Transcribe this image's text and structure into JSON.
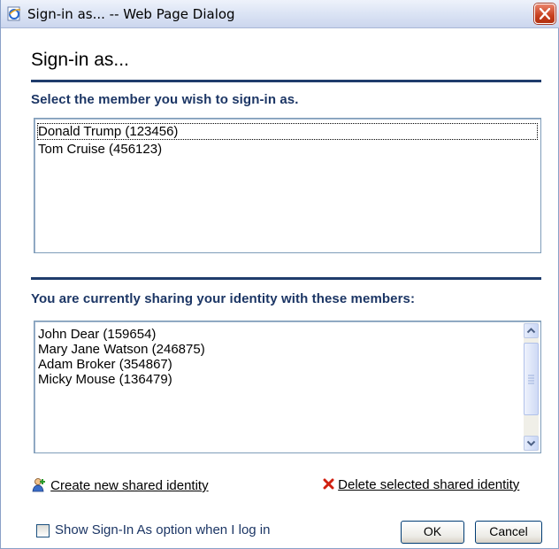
{
  "window": {
    "title": "Sign-in as... -- Web Page Dialog",
    "icon": "ie-page-icon",
    "close_icon": "close-icon"
  },
  "dialog": {
    "heading": "Sign-in as...",
    "select_label": "Select the member you wish to sign-in as.",
    "members": [
      {
        "label": "Donald Trump (123456)",
        "focused": true
      },
      {
        "label": "Tom Cruise (456123)",
        "focused": false
      }
    ],
    "sharing_label": "You are currently sharing your identity with these members:",
    "shared_members": [
      {
        "label": "John Dear (159654)"
      },
      {
        "label": "Mary Jane Watson (246875)"
      },
      {
        "label": "Adam Broker (354867)"
      },
      {
        "label": "Micky Mouse (136479)"
      }
    ],
    "create_link": "Create new shared identity",
    "delete_link": "Delete selected shared identity",
    "show_option_label": "Show Sign-In As option when I log in",
    "show_option_checked": false,
    "ok_button": "OK",
    "cancel_button": "Cancel"
  },
  "colors": {
    "accent": "#1c3665",
    "rule": "#1f3c6c",
    "close": "#c7401f",
    "delete_x": "#d02010"
  }
}
